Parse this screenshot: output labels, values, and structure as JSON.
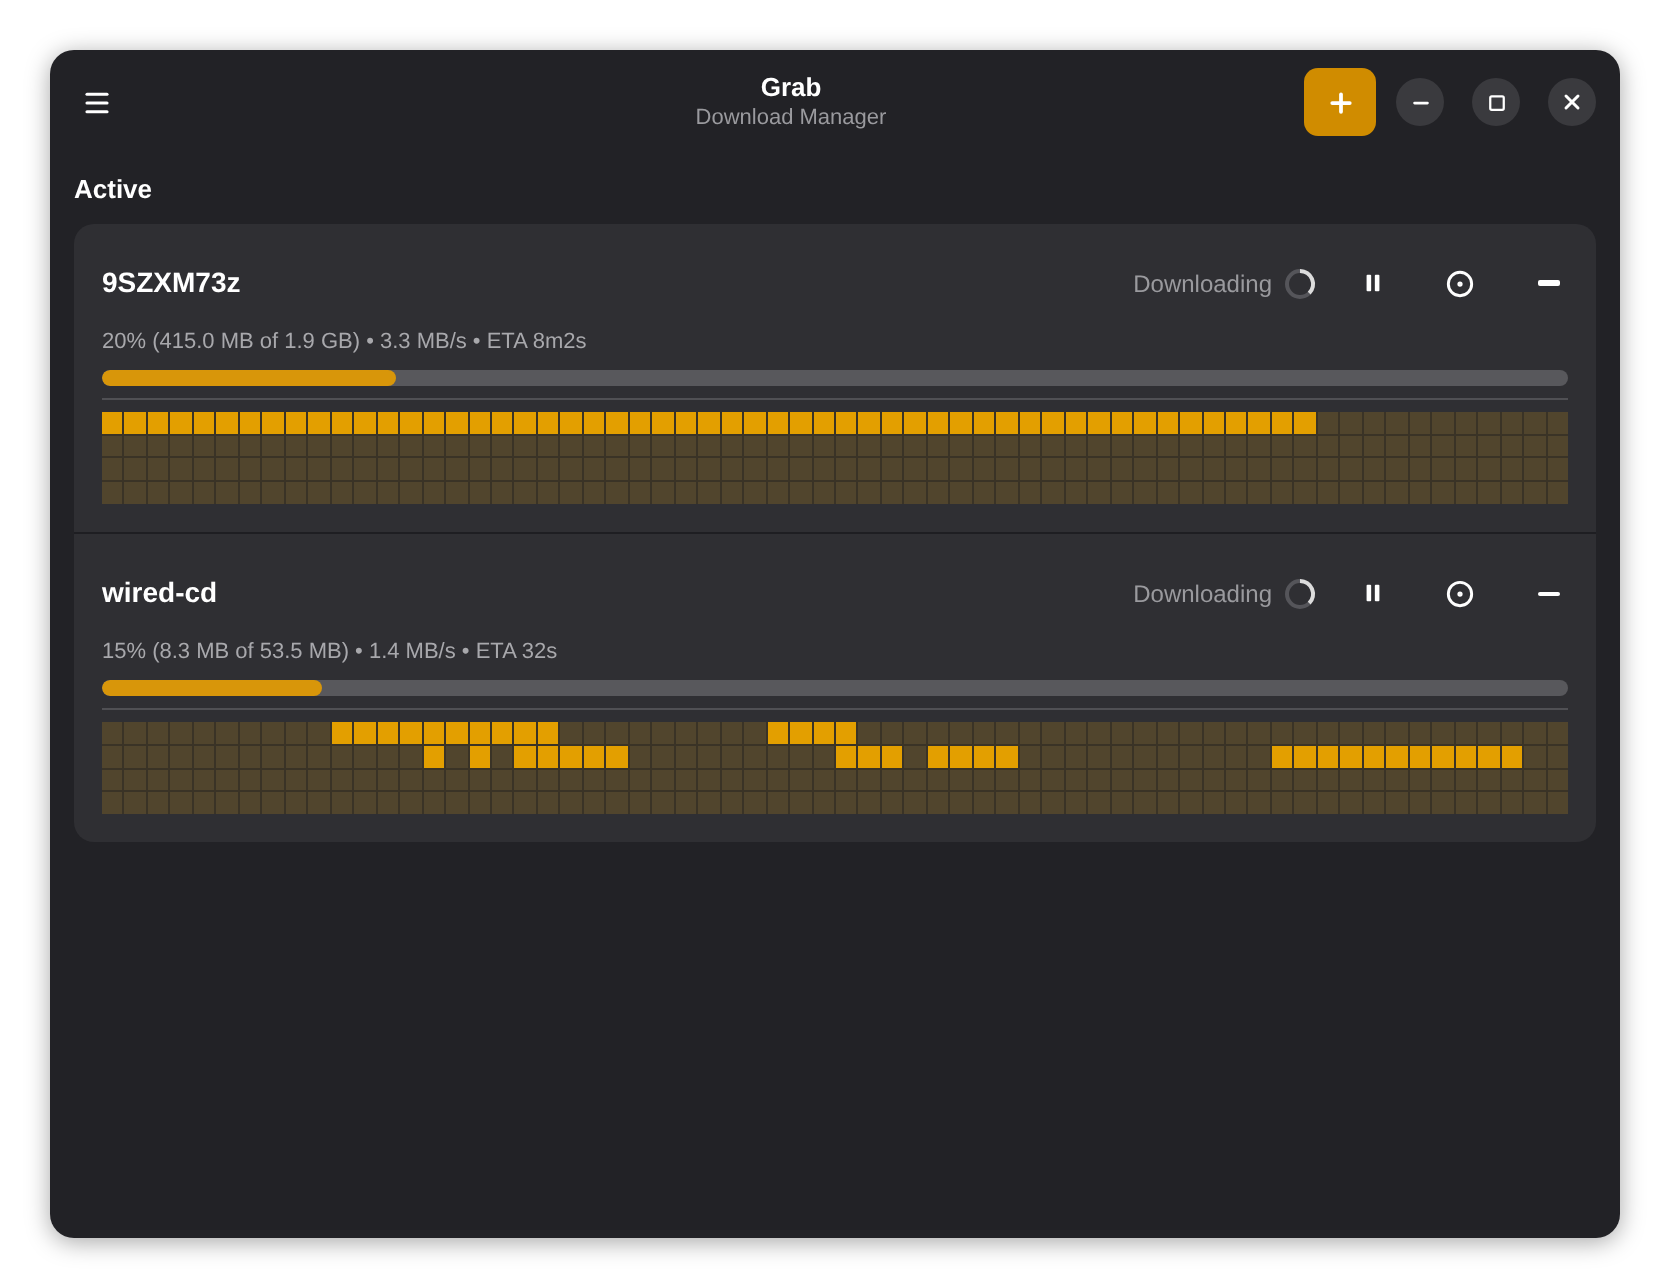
{
  "window": {
    "title": "Grab",
    "subtitle": "Download Manager"
  },
  "section_title": "Active",
  "downloads": [
    {
      "name": "9SZXM73z",
      "status": "Downloading",
      "progress_text": "20% (415.0 MB of 1.9 GB) • 3.3 MB/s • ETA 8m2s",
      "level": 0.2,
      "piece_rows": [
        [
          true,
          true,
          true,
          true,
          true,
          true,
          true,
          true,
          true,
          true,
          true,
          true,
          true,
          true,
          true,
          true,
          true,
          true,
          true,
          true,
          true,
          true,
          true,
          true,
          true,
          true,
          true,
          true,
          true,
          true,
          true,
          true,
          true,
          true,
          true,
          true,
          true,
          true,
          true,
          true,
          true,
          true,
          true,
          true,
          true,
          true,
          true,
          true,
          true,
          true,
          true,
          true,
          true,
          false,
          false,
          false,
          false,
          false,
          false,
          false,
          false,
          false,
          false,
          false
        ],
        [
          false,
          false,
          false,
          false,
          false,
          false,
          false,
          false,
          false,
          false,
          false,
          false,
          false,
          false,
          false,
          false,
          false,
          false,
          false,
          false,
          false,
          false,
          false,
          false,
          false,
          false,
          false,
          false,
          false,
          false,
          false,
          false,
          false,
          false,
          false,
          false,
          false,
          false,
          false,
          false,
          false,
          false,
          false,
          false,
          false,
          false,
          false,
          false,
          false,
          false,
          false,
          false,
          false,
          false,
          false,
          false,
          false,
          false,
          false,
          false,
          false,
          false,
          false,
          false
        ],
        [
          false,
          false,
          false,
          false,
          false,
          false,
          false,
          false,
          false,
          false,
          false,
          false,
          false,
          false,
          false,
          false,
          false,
          false,
          false,
          false,
          false,
          false,
          false,
          false,
          false,
          false,
          false,
          false,
          false,
          false,
          false,
          false,
          false,
          false,
          false,
          false,
          false,
          false,
          false,
          false,
          false,
          false,
          false,
          false,
          false,
          false,
          false,
          false,
          false,
          false,
          false,
          false,
          false,
          false,
          false,
          false,
          false,
          false,
          false,
          false,
          false,
          false,
          false,
          false
        ],
        [
          false,
          false,
          false,
          false,
          false,
          false,
          false,
          false,
          false,
          false,
          false,
          false,
          false,
          false,
          false,
          false,
          false,
          false,
          false,
          false,
          false,
          false,
          false,
          false,
          false,
          false,
          false,
          false,
          false,
          false,
          false,
          false,
          false,
          false,
          false,
          false,
          false,
          false,
          false,
          false,
          false,
          false,
          false,
          false,
          false,
          false,
          false,
          false,
          false,
          false,
          false,
          false,
          false,
          false,
          false,
          false,
          false,
          false,
          false,
          false,
          false,
          false,
          false,
          false
        ]
      ]
    },
    {
      "name": "wired-cd",
      "status": "Downloading",
      "progress_text": "15% (8.3 MB of 53.5 MB) • 1.4 MB/s • ETA 32s",
      "level": 0.15,
      "piece_rows": [
        [
          false,
          false,
          false,
          false,
          false,
          false,
          false,
          false,
          false,
          false,
          true,
          true,
          true,
          true,
          true,
          true,
          true,
          true,
          true,
          true,
          false,
          false,
          false,
          false,
          false,
          false,
          false,
          false,
          false,
          true,
          true,
          true,
          true,
          false,
          false,
          false,
          false,
          false,
          false,
          false,
          false,
          false,
          false,
          false,
          false,
          false,
          false,
          false,
          false,
          false,
          false,
          false,
          false,
          false,
          false,
          false,
          false,
          false,
          false,
          false,
          false,
          false,
          false,
          false
        ],
        [
          false,
          false,
          false,
          false,
          false,
          false,
          false,
          false,
          false,
          false,
          false,
          false,
          false,
          false,
          true,
          false,
          true,
          false,
          true,
          true,
          true,
          true,
          true,
          false,
          false,
          false,
          false,
          false,
          false,
          false,
          false,
          false,
          true,
          true,
          true,
          false,
          true,
          true,
          true,
          true,
          false,
          false,
          false,
          false,
          false,
          false,
          false,
          false,
          false,
          false,
          false,
          true,
          true,
          true,
          true,
          true,
          true,
          true,
          true,
          true,
          true,
          true,
          false,
          false
        ],
        [
          false,
          false,
          false,
          false,
          false,
          false,
          false,
          false,
          false,
          false,
          false,
          false,
          false,
          false,
          false,
          false,
          false,
          false,
          false,
          false,
          false,
          false,
          false,
          false,
          false,
          false,
          false,
          false,
          false,
          false,
          false,
          false,
          false,
          false,
          false,
          false,
          false,
          false,
          false,
          false,
          false,
          false,
          false,
          false,
          false,
          false,
          false,
          false,
          false,
          false,
          false,
          false,
          false,
          false,
          false,
          false,
          false,
          false,
          false,
          false,
          false,
          false,
          false,
          false
        ],
        [
          false,
          false,
          false,
          false,
          false,
          false,
          false,
          false,
          false,
          false,
          false,
          false,
          false,
          false,
          false,
          false,
          false,
          false,
          false,
          false,
          false,
          false,
          false,
          false,
          false,
          false,
          false,
          false,
          false,
          false,
          false,
          false,
          false,
          false,
          false,
          false,
          false,
          false,
          false,
          false,
          false,
          false,
          false,
          false,
          false,
          false,
          false,
          false,
          false,
          false,
          false,
          false,
          false,
          false,
          false,
          false,
          false,
          false,
          false,
          false,
          false,
          false,
          false,
          false
        ]
      ]
    }
  ]
}
